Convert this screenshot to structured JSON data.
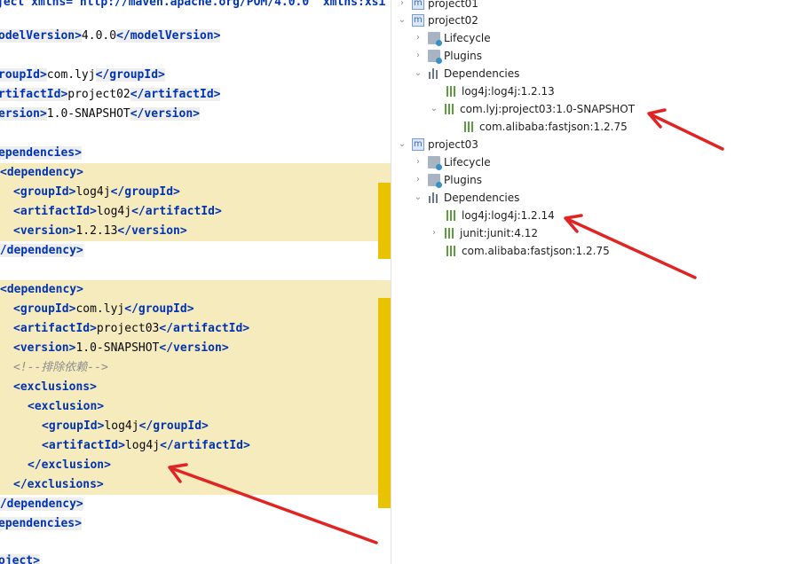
{
  "editor": {
    "lines": [
      {
        "t": "xml",
        "text": "ject xmlns=\"http://maven.apache.org/POM/4.0.0\" xmlns:xsi"
      },
      {
        "t": "tag",
        "a": "odelVersion>",
        "b": "4.0.0",
        "c": "</modelVersion>"
      },
      {
        "t": "tag",
        "a": "roupId>",
        "b": "com.lyj",
        "c": "</groupId>"
      },
      {
        "t": "tag",
        "a": "rtifactId>",
        "b": "project02",
        "c": "</artifactId>"
      },
      {
        "t": "tag",
        "a": "ersion>",
        "b": "1.0-SNAPSHOT",
        "c": "</version>"
      },
      {
        "t": "open",
        "a": "ependencies>"
      },
      {
        "t": "open",
        "a": "<dependency>"
      },
      {
        "t": "tag",
        "a": "<groupId>",
        "b": "log4j",
        "c": "</groupId>"
      },
      {
        "t": "tag",
        "a": "<artifactId>",
        "b": "log4j",
        "c": "</artifactId>"
      },
      {
        "t": "tag",
        "a": "<version>",
        "b": "1.2.13",
        "c": "</version>"
      },
      {
        "t": "open",
        "a": "</dependency>"
      },
      {
        "t": "open",
        "a": "<dependency>"
      },
      {
        "t": "tag",
        "a": "<groupId>",
        "b": "com.lyj",
        "c": "</groupId>"
      },
      {
        "t": "tag",
        "a": "<artifactId>",
        "b": "project03",
        "c": "</artifactId>"
      },
      {
        "t": "tag",
        "a": "<version>",
        "b": "1.0-SNAPSHOT",
        "c": "</version>"
      },
      {
        "t": "cmt",
        "a": "<!--排除依赖-->"
      },
      {
        "t": "open",
        "a": "<exclusions>"
      },
      {
        "t": "open",
        "a": "<exclusion>"
      },
      {
        "t": "tag",
        "a": "<groupId>",
        "b": "log4j",
        "c": "</groupId>"
      },
      {
        "t": "tag",
        "a": "<artifactId>",
        "b": "log4j",
        "c": "</artifactId>"
      },
      {
        "t": "open",
        "a": "</exclusion>"
      },
      {
        "t": "open",
        "a": "</exclusions>"
      },
      {
        "t": "open",
        "a": "</dependency>"
      },
      {
        "t": "open",
        "a": "ependencies>"
      },
      {
        "t": "open",
        "a": "oject>"
      }
    ]
  },
  "tree": {
    "nodes": [
      {
        "label": "project01",
        "icon": "maven-module-icon",
        "chev": "right"
      },
      {
        "label": "project02",
        "icon": "maven-module-icon",
        "chev": "down"
      },
      {
        "label": "Lifecycle",
        "icon": "lifecycle-folder-icon",
        "chev": "right"
      },
      {
        "label": "Plugins",
        "icon": "plugins-folder-icon",
        "chev": "right"
      },
      {
        "label": "Dependencies",
        "icon": "dependencies-icon",
        "chev": "down"
      },
      {
        "label": "log4j:log4j:1.2.13",
        "icon": "library-icon",
        "chev": ""
      },
      {
        "label": "com.lyj:project03:1.0-SNAPSHOT",
        "icon": "library-icon",
        "chev": "down"
      },
      {
        "label": "com.alibaba:fastjson:1.2.75",
        "icon": "library-icon",
        "chev": ""
      },
      {
        "label": "project03",
        "icon": "maven-module-icon",
        "chev": "down"
      },
      {
        "label": "Lifecycle",
        "icon": "lifecycle-folder-icon",
        "chev": "right"
      },
      {
        "label": "Plugins",
        "icon": "plugins-folder-icon",
        "chev": "right"
      },
      {
        "label": "Dependencies",
        "icon": "dependencies-icon",
        "chev": "down"
      },
      {
        "label": "log4j:log4j:1.2.14",
        "icon": "library-icon",
        "chev": ""
      },
      {
        "label": "junit:junit:4.12",
        "icon": "library-icon",
        "chev": "right"
      },
      {
        "label": "com.alibaba:fastjson:1.2.75",
        "icon": "library-icon",
        "chev": ""
      }
    ]
  },
  "annotations": {
    "arrow_color": "#e02424"
  },
  "colors": {
    "highlight": "#f6ebbc",
    "gutter_marker": "#e8c300",
    "tag": "#0033b3",
    "comment": "#8c8c8c"
  }
}
